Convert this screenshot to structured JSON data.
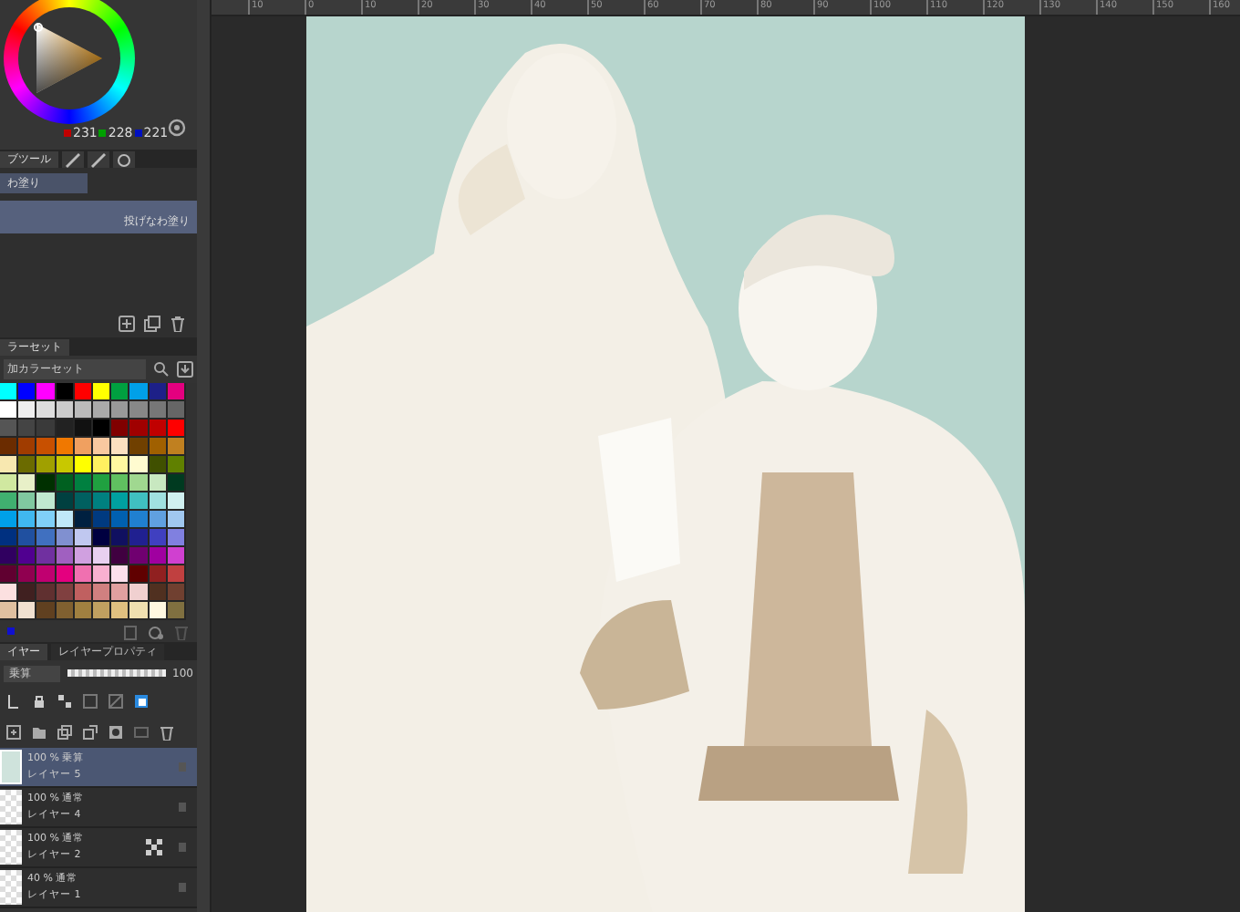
{
  "color_wheel": {
    "values": [
      {
        "text": "231",
        "color": "#c00000"
      },
      {
        "text": "228",
        "color": "#00a000"
      },
      {
        "text": "221",
        "color": "#0010c0"
      }
    ]
  },
  "subtool": {
    "tab": "ブツール",
    "items": [
      {
        "label": "わ塗り",
        "selected": false
      },
      {
        "label": "投げなわ塗り",
        "selected": true
      }
    ]
  },
  "colorset": {
    "tab": "ラーセット",
    "dropdown": "加カラーセット",
    "swatches": [
      {
        "color": "#00ffff"
      },
      {
        "color": "#0000ff"
      },
      {
        "color": "#ff00ff"
      },
      {
        "color": "#000000"
      },
      {
        "color": "#ff0000"
      },
      {
        "color": "#ffff00"
      },
      {
        "color": "#00a040"
      },
      {
        "color": "#00a0e8"
      },
      {
        "color": "#1d2088"
      },
      {
        "color": "#e4007f"
      },
      {
        "color": "#ffffff"
      },
      {
        "color": "#eeeeee"
      },
      {
        "color": "#dddddd"
      },
      {
        "color": "#cccccc"
      },
      {
        "color": "#bbbbbb"
      },
      {
        "color": "#aaaaaa"
      },
      {
        "color": "#999999"
      },
      {
        "color": "#888888"
      },
      {
        "color": "#777777"
      },
      {
        "color": "#666666"
      },
      {
        "color": "#555555"
      },
      {
        "color": "#444444"
      },
      {
        "color": "#3a3a3a"
      },
      {
        "color": "#222222"
      },
      {
        "color": "#111111"
      },
      {
        "color": "#000000"
      },
      {
        "color": "#800000"
      },
      {
        "color": "#a00000"
      },
      {
        "color": "#c00000"
      },
      {
        "color": "#ff0000"
      },
      {
        "color": "#6b2c00"
      },
      {
        "color": "#a03c00"
      },
      {
        "color": "#c85000"
      },
      {
        "color": "#f07800"
      },
      {
        "color": "#f0a060"
      },
      {
        "color": "#f8c8a0"
      },
      {
        "color": "#fbe0c0"
      },
      {
        "color": "#704000"
      },
      {
        "color": "#a06000"
      },
      {
        "color": "#c08020"
      },
      {
        "color": "#f8e8b0"
      },
      {
        "color": "#6b6b00"
      },
      {
        "color": "#a0a000"
      },
      {
        "color": "#c8c800"
      },
      {
        "color": "#ffff00"
      },
      {
        "color": "#fff060"
      },
      {
        "color": "#fff8a0"
      },
      {
        "color": "#fffbd0"
      },
      {
        "color": "#405000"
      },
      {
        "color": "#608000"
      },
      {
        "color": "#d0e8a0"
      },
      {
        "color": "#e8f0c8"
      },
      {
        "color": "#003000"
      },
      {
        "color": "#006020"
      },
      {
        "color": "#008040"
      },
      {
        "color": "#20a040"
      },
      {
        "color": "#60c060"
      },
      {
        "color": "#a0d890"
      },
      {
        "color": "#c8e8c0"
      },
      {
        "color": "#003a20"
      },
      {
        "color": "#40b070"
      },
      {
        "color": "#80c8a0"
      },
      {
        "color": "#c0e8d0"
      },
      {
        "color": "#004040"
      },
      {
        "color": "#006060"
      },
      {
        "color": "#008080"
      },
      {
        "color": "#00a0a0"
      },
      {
        "color": "#40c0c0"
      },
      {
        "color": "#a0e0e0"
      },
      {
        "color": "#d0f0f0"
      },
      {
        "color": "#00a0e8"
      },
      {
        "color": "#40b8f0"
      },
      {
        "color": "#80d0f8"
      },
      {
        "color": "#c0e8f8"
      },
      {
        "color": "#002040"
      },
      {
        "color": "#003a80"
      },
      {
        "color": "#0060b0"
      },
      {
        "color": "#2080d0"
      },
      {
        "color": "#60a0e0"
      },
      {
        "color": "#a0c8f0"
      },
      {
        "color": "#003080"
      },
      {
        "color": "#2050a0"
      },
      {
        "color": "#4070c0"
      },
      {
        "color": "#8090d0"
      },
      {
        "color": "#c0c8f0"
      },
      {
        "color": "#000040"
      },
      {
        "color": "#101060"
      },
      {
        "color": "#202090"
      },
      {
        "color": "#4040c0"
      },
      {
        "color": "#8080e0"
      },
      {
        "color": "#300060"
      },
      {
        "color": "#500090"
      },
      {
        "color": "#7030a0"
      },
      {
        "color": "#a060c0"
      },
      {
        "color": "#d0a0e0"
      },
      {
        "color": "#e8d0f0"
      },
      {
        "color": "#400040"
      },
      {
        "color": "#700070"
      },
      {
        "color": "#a000a0"
      },
      {
        "color": "#d040d0"
      },
      {
        "color": "#600030"
      },
      {
        "color": "#900050"
      },
      {
        "color": "#c00070"
      },
      {
        "color": "#e4007f"
      },
      {
        "color": "#f070b0"
      },
      {
        "color": "#f8b0d0"
      },
      {
        "color": "#fce0ec"
      },
      {
        "color": "#600000"
      },
      {
        "color": "#902020"
      },
      {
        "color": "#c04040"
      },
      {
        "color": "#fce0e0"
      },
      {
        "color": "#402020"
      },
      {
        "color": "#603030"
      },
      {
        "color": "#804040"
      },
      {
        "color": "#c06060"
      },
      {
        "color": "#d08080"
      },
      {
        "color": "#e0a0a0"
      },
      {
        "color": "#f0d0d0"
      },
      {
        "color": "#503020"
      },
      {
        "color": "#704030"
      },
      {
        "color": "#e0c0a0"
      },
      {
        "color": "#f0e0d0"
      },
      {
        "color": "#604020"
      },
      {
        "color": "#806030"
      },
      {
        "color": "#a08040"
      },
      {
        "color": "#c0a060"
      },
      {
        "color": "#e0c080"
      },
      {
        "color": "#f0e0b0"
      },
      {
        "color": "#fff8e0"
      },
      {
        "color": "#807040"
      }
    ]
  },
  "layer_panel": {
    "tabs": [
      {
        "label": "イヤー",
        "selected": true
      },
      {
        "label": "レイヤープロパティ",
        "selected": false
      }
    ],
    "blend_mode": "乗算",
    "opacity": "100",
    "opacity_slider": {
      "level": 1
    },
    "layers": [
      {
        "opacity": "100 %",
        "blend": "乗算",
        "name": "レイヤー 5",
        "selected": true,
        "masked": false
      },
      {
        "opacity": "100 %",
        "blend": "通常",
        "name": "レイヤー 4",
        "selected": false,
        "masked": false
      },
      {
        "opacity": "100 %",
        "blend": "通常",
        "name": "レイヤー 2",
        "selected": false,
        "masked": true
      },
      {
        "opacity": "40 %",
        "blend": "通常",
        "name": "レイヤー 1",
        "selected": false,
        "masked": false
      }
    ]
  },
  "ruler": {
    "labels": [
      "10",
      "0",
      "10",
      "20",
      "30",
      "40",
      "50",
      "60",
      "70",
      "80",
      "90",
      "100",
      "110",
      "120",
      "130",
      "140",
      "150",
      "160"
    ]
  }
}
